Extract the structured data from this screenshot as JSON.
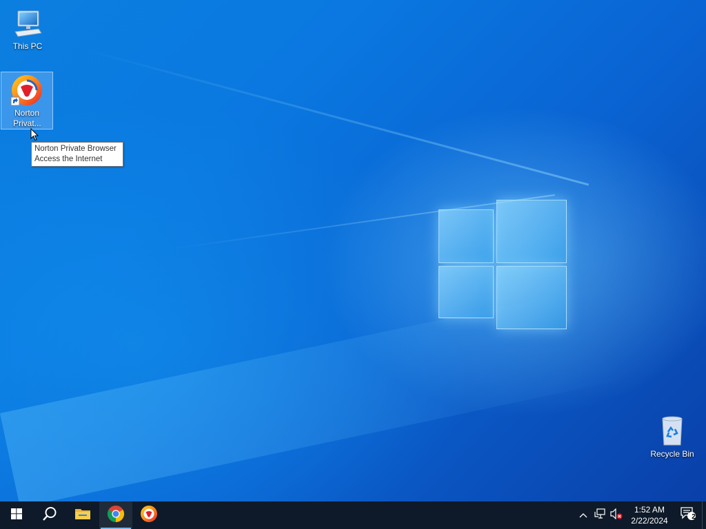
{
  "desktop": {
    "icons": [
      {
        "label": "This PC",
        "icon": "computer-icon"
      },
      {
        "label": "Norton Privat...",
        "icon": "norton-private-browser-icon"
      },
      {
        "label": "Recycle Bin",
        "icon": "recycle-bin-icon"
      }
    ],
    "tooltip": {
      "line1": "Norton Private Browser",
      "line2": "Access the Internet"
    }
  },
  "taskbar": {
    "buttons": [
      {
        "name": "Start",
        "icon": "windows-start-icon"
      },
      {
        "name": "Search",
        "icon": "search-icon"
      },
      {
        "name": "File Explorer",
        "icon": "file-explorer-icon"
      },
      {
        "name": "Google Chrome",
        "icon": "chrome-icon"
      },
      {
        "name": "Norton Private Browser",
        "icon": "norton-private-browser-icon"
      }
    ],
    "tray": {
      "time": "1:52 AM",
      "date": "2/22/2024",
      "notification_count": "2"
    }
  },
  "colors": {
    "taskbar_bg": "#0e1a29",
    "accent": "#76b9ed",
    "wallpaper_blue": "#0a63d2"
  }
}
